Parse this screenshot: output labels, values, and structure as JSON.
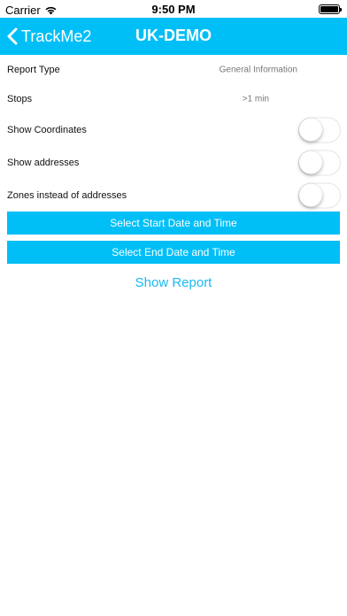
{
  "status": {
    "carrier": "Carrier",
    "time": "9:50 PM"
  },
  "nav": {
    "back_label": "TrackMe2",
    "title": "UK-DEMO"
  },
  "form": {
    "report_type_label": "Report Type",
    "report_type_value": "General Information",
    "stops_label": "Stops",
    "stops_value": ">1 min",
    "toggles": [
      {
        "label": "Show Coordinates",
        "on": false
      },
      {
        "label": "Show addresses",
        "on": false
      },
      {
        "label": "Zones instead of addresses",
        "on": false
      }
    ],
    "start_button": "Select Start Date and Time",
    "end_button": "Select End Date and Time",
    "show_report": "Show Report"
  },
  "colors": {
    "accent": "#00bff7"
  },
  "icons": {
    "wifi": "wifi-icon",
    "battery": "battery-icon",
    "back": "chevron-left-icon"
  }
}
